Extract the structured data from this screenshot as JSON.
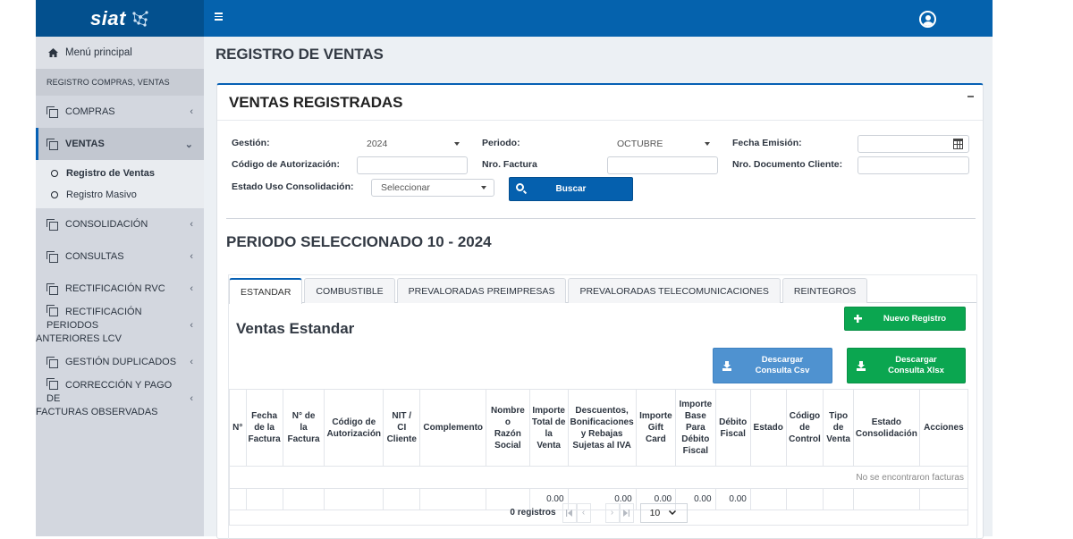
{
  "brand": {
    "name": "siat"
  },
  "sidebar": {
    "home_label": "Menú principal",
    "section_header": "REGISTRO COMPRAS, VENTAS",
    "items": [
      {
        "label": "COMPRAS",
        "chevron": "‹"
      },
      {
        "label": "VENTAS",
        "chevron": "⌄",
        "active": true,
        "children": [
          {
            "label": "Registro de Ventas",
            "current": true
          },
          {
            "label": "Registro Masivo"
          }
        ]
      },
      {
        "label": "CONSOLIDACIÓN",
        "chevron": "‹"
      },
      {
        "label": "CONSULTAS",
        "chevron": "‹"
      },
      {
        "label": "RECTIFICACIÓN RVC",
        "chevron": "‹"
      },
      {
        "label_line1": "RECTIFICACIÓN PERIODOS",
        "label_line2": "ANTERIORES LCV",
        "chevron": "‹"
      },
      {
        "label": "GESTIÓN DUPLICADOS",
        "chevron": "‹"
      },
      {
        "label_line1": "CORRECCIÓN Y PAGO DE",
        "label_line2": "FACTURAS OBSERVADAS",
        "chevron": "‹"
      }
    ]
  },
  "header": {
    "page_title": "REGISTRO DE VENTAS"
  },
  "panel": {
    "title": "VENTAS REGISTRADAS",
    "collapse_symbol": "−"
  },
  "filters": {
    "gestion": {
      "label": "Gestión:",
      "value": "2024"
    },
    "periodo": {
      "label": "Periodo:",
      "value": "OCTUBRE"
    },
    "fecha_emision": {
      "label": "Fecha Emisión:",
      "value": ""
    },
    "codigo_autorizacion": {
      "label": "Código de Autorización:",
      "value": ""
    },
    "nro_factura": {
      "label": "Nro. Factura",
      "value": ""
    },
    "nro_documento": {
      "label": "Nro. Documento Cliente:",
      "value": ""
    },
    "estado_uso": {
      "label": "Estado Uso Consolidación:",
      "value": "Seleccionar"
    },
    "buscar_label": "Buscar"
  },
  "period_title": "PERIODO SELECCIONADO 10 - 2024",
  "tabs": [
    {
      "label": "ESTANDAR",
      "active": true
    },
    {
      "label": "COMBUSTIBLE"
    },
    {
      "label": "PREVALORADAS PREIMPRESAS"
    },
    {
      "label": "PREVALORADAS TELECOMUNICACIONES"
    },
    {
      "label": "REINTEGROS"
    }
  ],
  "section_title": "Ventas Estandar",
  "buttons": {
    "nuevo_registro": "Nuevo Registro",
    "descargar_csv_line1": "Descargar",
    "descargar_csv_line2": "Consulta Csv",
    "descargar_xlsx_line1": "Descargar",
    "descargar_xlsx_line2": "Consulta Xlsx"
  },
  "colors": {
    "brand_blue": "#0562ad",
    "green": "#0ba650",
    "light_blue": "#4f92d0",
    "sidebar_bg": "#d3d7df"
  },
  "table": {
    "columns": [
      [
        "N°"
      ],
      [
        "Fecha",
        "de la",
        "Factura"
      ],
      [
        "N° de",
        "la",
        "Factura"
      ],
      [
        "Código de",
        "Autorización"
      ],
      [
        "NIT /",
        "CI",
        "Cliente"
      ],
      [
        "Complemento"
      ],
      [
        "Nombre",
        "o",
        "Razón",
        "Social"
      ],
      [
        "Importe",
        "Total de",
        "la",
        "Venta"
      ],
      [
        "Descuentos,",
        "Bonificaciones",
        "y Rebajas",
        "Sujetas al IVA"
      ],
      [
        "Importe",
        "Gift",
        "Card"
      ],
      [
        "Importe",
        "Base",
        "Para",
        "Débito",
        "Fiscal"
      ],
      [
        "Débito",
        "Fiscal"
      ],
      [
        "Estado"
      ],
      [
        "Código",
        "de",
        "Control"
      ],
      [
        "Tipo",
        "de",
        "Venta"
      ],
      [
        "Estado",
        "Consolidación"
      ],
      [
        "Acciones"
      ]
    ],
    "empty_message": "No se encontraron facturas",
    "totals": [
      "",
      "",
      "",
      "",
      "",
      "",
      "",
      "0.00",
      "0.00",
      "0.00",
      "0.00",
      "0.00",
      "",
      "",
      "",
      "",
      ""
    ]
  },
  "pager": {
    "count_label": "0 registros",
    "first": "⏮",
    "prev": "‹",
    "next": "›",
    "last": "⏭",
    "page_size": "10"
  }
}
